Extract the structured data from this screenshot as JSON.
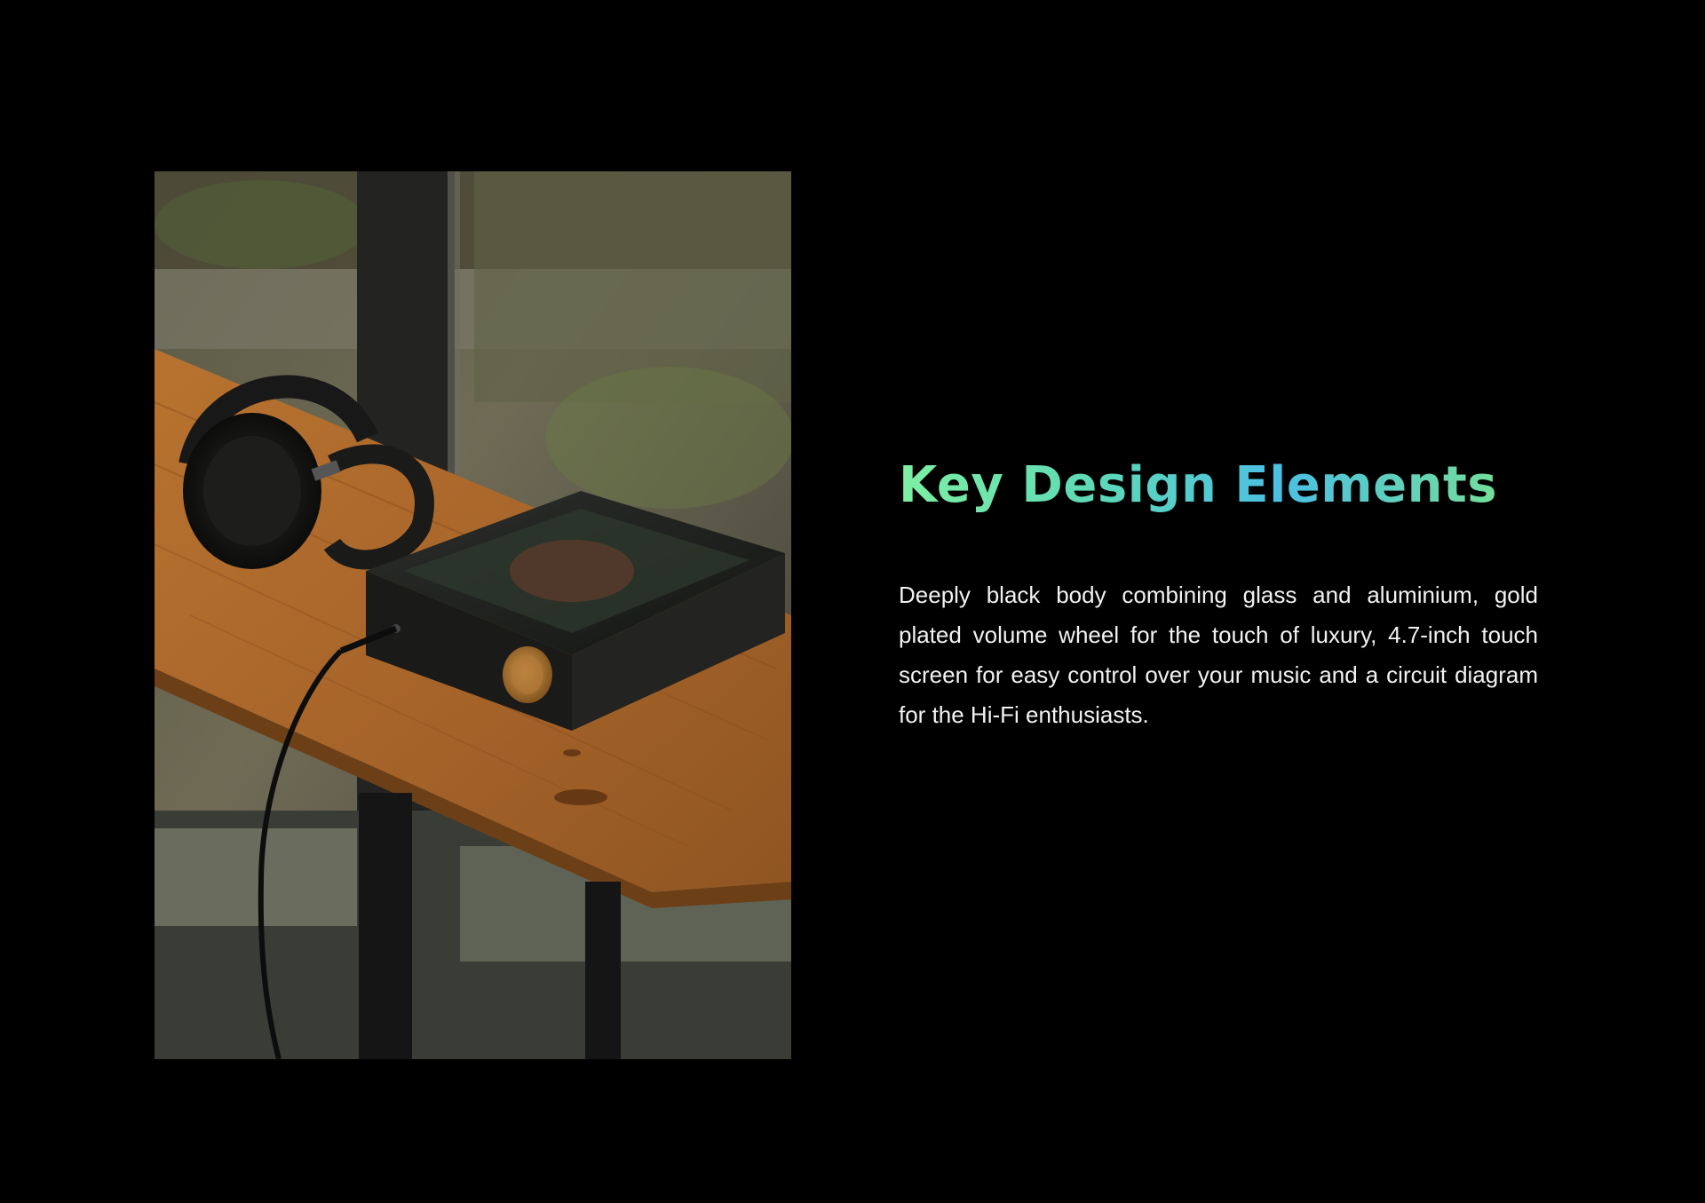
{
  "section": {
    "title": "Key Design Elements",
    "description": "Deeply black body combining glass and aluminium, gold plated volume wheel for the touch of luxury, 4.7-inch touch screen for easy control over your music and a circuit diagram for the Hi-Fi enthusiasts."
  },
  "photo": {
    "subject": "headphones-and-streaming-dac-on-wooden-table"
  },
  "colors": {
    "background": "#000000",
    "title_gradient": [
      "#7df0a3",
      "#4bbfe3",
      "#7ce48c"
    ],
    "body_text": "#f2f2f2"
  }
}
